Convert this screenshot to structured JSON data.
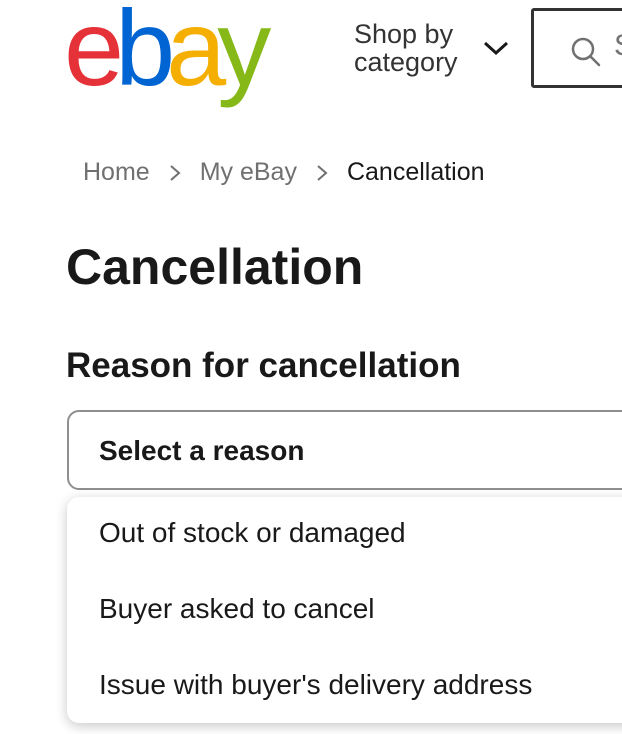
{
  "header": {
    "logo": {
      "e": "e",
      "b": "b",
      "a": "a",
      "y": "y"
    },
    "shop_by_category": "Shop by\ncategory",
    "search_placeholder": "S",
    "colors": {
      "red": "#e53238",
      "blue": "#0064d2",
      "yellow": "#f5af02",
      "green": "#86b817"
    }
  },
  "breadcrumb": {
    "items": [
      "Home",
      "My eBay",
      "Cancellation"
    ]
  },
  "page_title": "Cancellation",
  "reason_section": {
    "title": "Reason for cancellation",
    "selected": "Select a reason",
    "options": [
      "Out of stock or damaged",
      "Buyer asked to cancel",
      "Issue with buyer's delivery address"
    ]
  },
  "icons": {
    "chevron": "chevron-down-icon",
    "search": "search-icon",
    "separator": "chevron-right-icon"
  }
}
